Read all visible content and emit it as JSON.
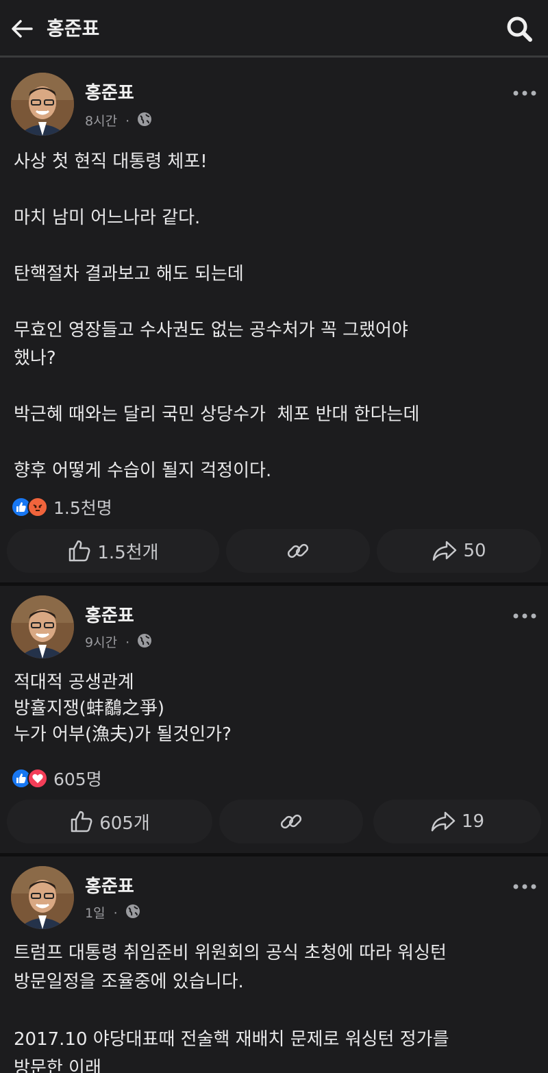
{
  "header": {
    "title": "홍준표"
  },
  "posts": [
    {
      "author": "홍준표",
      "time": "8시간",
      "text": "사상 첫 현직 대통령 체포!\n\n마치 남미 어느나라 같다.\n\n탄핵절차 결과보고 해도 되는데\n\n무효인 영장들고 수사권도 없는 공수처가 꼭 그랬어야\n했나?\n\n박근혜 때와는 달리 국민 상당수가  체포 반대 한다는데\n\n향후 어떻게 수습이 될지 걱정이다.",
      "reaction_total": "1.5천명",
      "reactions": [
        "like",
        "angry"
      ],
      "like_count": "1.5천개",
      "share_count": "50"
    },
    {
      "author": "홍준표",
      "time": "9시간",
      "text": "적대적 공생관계\n방휼지쟁(蚌鷸之爭)\n누가 어부(漁夫)가 될것인가?",
      "reaction_total": "605명",
      "reactions": [
        "like",
        "love"
      ],
      "like_count": "605개",
      "share_count": "19"
    },
    {
      "author": "홍준표",
      "time": "1일",
      "text": "트럼프 대통령 취임준비 위원회의 공식 초청에 따라 워싱턴\n방문일정을 조율중에 있습니다.\n\n2017.10 야당대표때 전술핵 재배치 문제로 워싱턴 정가를\n방문한 이래"
    }
  ],
  "colors": {
    "background": "#1c1c1e",
    "like_blue": "#1877f2",
    "angry_orange": "#f0643c",
    "love_red": "#f33e58"
  }
}
